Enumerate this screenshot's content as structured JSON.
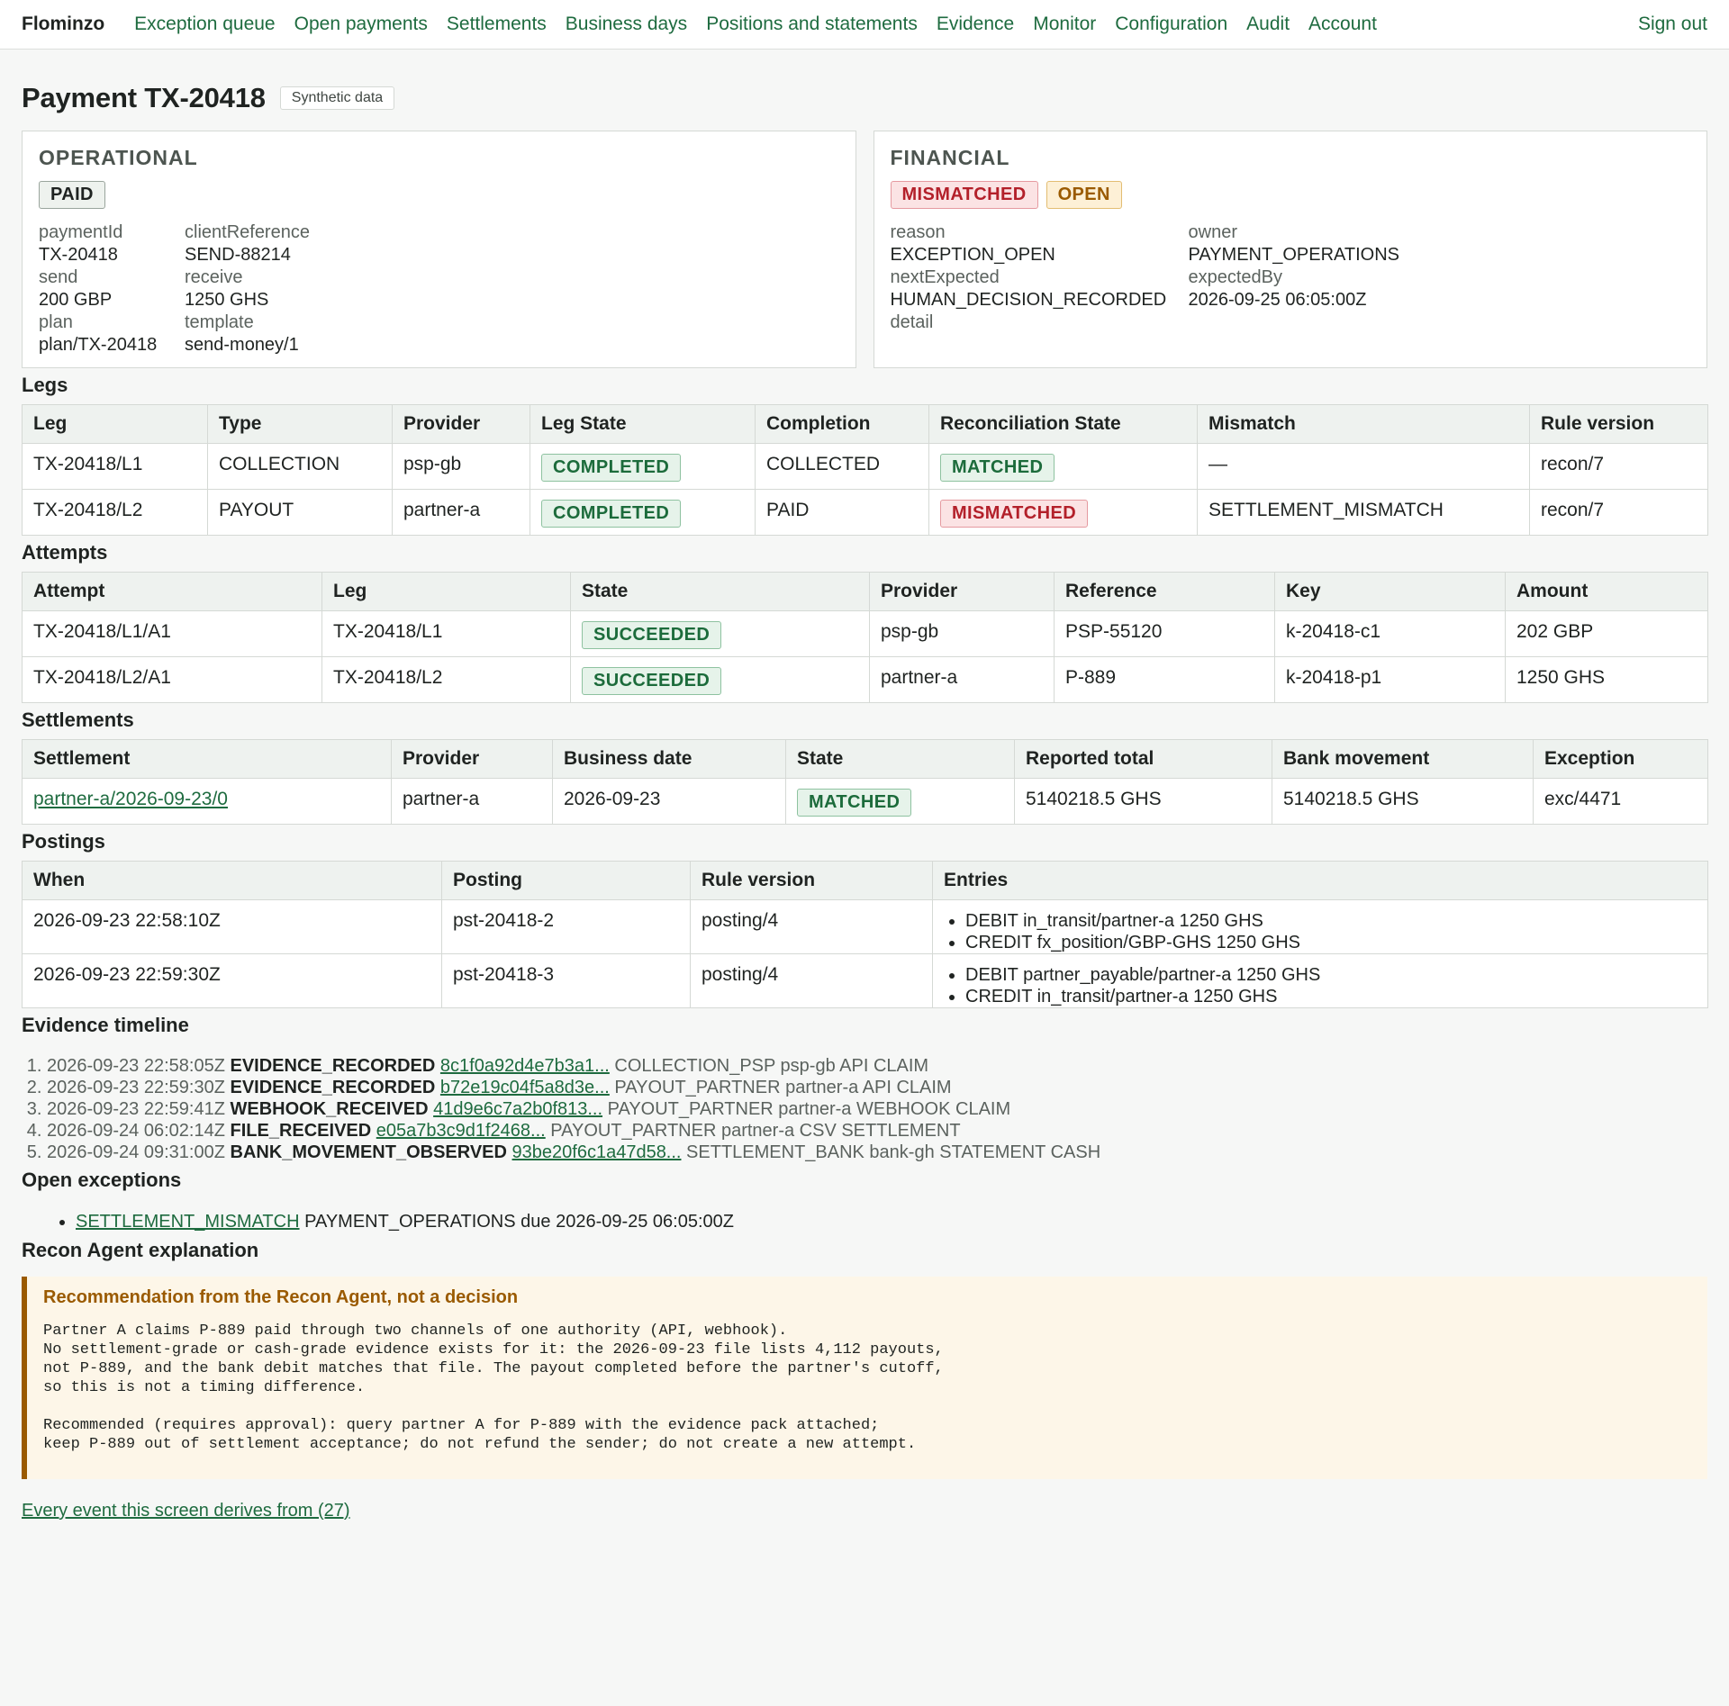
{
  "brand": "Flominzo",
  "nav": [
    "Exception queue",
    "Open payments",
    "Settlements",
    "Business days",
    "Positions and statements",
    "Evidence",
    "Monitor",
    "Configuration",
    "Audit",
    "Account"
  ],
  "sign_out": "Sign out",
  "page": {
    "title": "Payment TX-20418",
    "tag": "Synthetic data"
  },
  "operational": {
    "title": "OPERATIONAL",
    "badge": "PAID",
    "fields": [
      {
        "k": "paymentId",
        "v": "TX-20418"
      },
      {
        "k": "clientReference",
        "v": "SEND-88214"
      },
      {
        "k": "send",
        "v": "200 GBP"
      },
      {
        "k": "receive",
        "v": "1250 GHS"
      },
      {
        "k": "plan",
        "v": "plan/TX-20418"
      },
      {
        "k": "template",
        "v": "send-money/1"
      }
    ]
  },
  "financial": {
    "title": "FINANCIAL",
    "badges": [
      "MISMATCHED",
      "OPEN"
    ],
    "fields": [
      {
        "k": "reason",
        "v": "EXCEPTION_OPEN"
      },
      {
        "k": "owner",
        "v": "PAYMENT_OPERATIONS"
      },
      {
        "k": "nextExpected",
        "v": "HUMAN_DECISION_RECORDED"
      },
      {
        "k": "expectedBy",
        "v": "2026-09-25 06:05:00Z"
      },
      {
        "k": "detail",
        "v": ""
      }
    ]
  },
  "legs": {
    "title": "Legs",
    "columns": [
      "Leg",
      "Type",
      "Provider",
      "Leg State",
      "Completion",
      "Reconciliation State",
      "Mismatch",
      "Rule version"
    ],
    "rows": [
      [
        "TX-20418/L1",
        "COLLECTION",
        "psp-gb",
        "COMPLETED",
        "COLLECTED",
        "MATCHED",
        "—",
        "recon/7"
      ],
      [
        "TX-20418/L2",
        "PAYOUT",
        "partner-a",
        "COMPLETED",
        "PAID",
        "MISMATCHED",
        "SETTLEMENT_MISMATCH",
        "recon/7"
      ]
    ]
  },
  "attempts": {
    "title": "Attempts",
    "columns": [
      "Attempt",
      "Leg",
      "State",
      "Provider",
      "Reference",
      "Key",
      "Amount"
    ],
    "rows": [
      [
        "TX-20418/L1/A1",
        "TX-20418/L1",
        "SUCCEEDED",
        "psp-gb",
        "PSP-55120",
        "k-20418-c1",
        "202 GBP"
      ],
      [
        "TX-20418/L2/A1",
        "TX-20418/L2",
        "SUCCEEDED",
        "partner-a",
        "P-889",
        "k-20418-p1",
        "1250 GHS"
      ]
    ]
  },
  "settlements": {
    "title": "Settlements",
    "columns": [
      "Settlement",
      "Provider",
      "Business date",
      "State",
      "Reported total",
      "Bank movement",
      "Exception"
    ],
    "rows": [
      [
        "partner-a/2026-09-23/0",
        "partner-a",
        "2026-09-23",
        "MATCHED",
        "5140218.5 GHS",
        "5140218.5 GHS",
        "exc/4471"
      ]
    ]
  },
  "postings": {
    "title": "Postings",
    "columns": [
      "When",
      "Posting",
      "Rule version",
      "Entries"
    ],
    "rows": [
      {
        "when": "2026-09-23 22:58:10Z",
        "posting": "pst-20418-2",
        "rule": "posting/4",
        "entries": [
          "DEBIT in_transit/partner-a 1250 GHS",
          "CREDIT fx_position/GBP-GHS 1250 GHS"
        ]
      },
      {
        "when": "2026-09-23 22:59:30Z",
        "posting": "pst-20418-3",
        "rule": "posting/4",
        "entries": [
          "DEBIT partner_payable/partner-a 1250 GHS",
          "CREDIT in_transit/partner-a 1250 GHS"
        ]
      }
    ]
  },
  "timeline": {
    "title": "Evidence timeline",
    "items": [
      {
        "ts": "2026-09-23 22:58:05Z",
        "event": "EVIDENCE_RECORDED",
        "hash": "8c1f0a92d4e7b3a1...",
        "desc": "COLLECTION_PSP psp-gb API CLAIM"
      },
      {
        "ts": "2026-09-23 22:59:30Z",
        "event": "EVIDENCE_RECORDED",
        "hash": "b72e19c04f5a8d3e...",
        "desc": "PAYOUT_PARTNER partner-a API CLAIM"
      },
      {
        "ts": "2026-09-23 22:59:41Z",
        "event": "WEBHOOK_RECEIVED",
        "hash": "41d9e6c7a2b0f813...",
        "desc": "PAYOUT_PARTNER partner-a WEBHOOK CLAIM"
      },
      {
        "ts": "2026-09-24 06:02:14Z",
        "event": "FILE_RECEIVED",
        "hash": "e05a7b3c9d1f2468...",
        "desc": "PAYOUT_PARTNER partner-a CSV SETTLEMENT"
      },
      {
        "ts": "2026-09-24 09:31:00Z",
        "event": "BANK_MOVEMENT_OBSERVED",
        "hash": "93be20f6c1a47d58...",
        "desc": "SETTLEMENT_BANK bank-gh STATEMENT CASH"
      }
    ]
  },
  "exceptions": {
    "title": "Open exceptions",
    "items": [
      {
        "code": "SETTLEMENT_MISMATCH",
        "desc": "PAYMENT_OPERATIONS due 2026-09-25 06:05:00Z"
      }
    ]
  },
  "agent": {
    "title": "Recon Agent explanation",
    "callout_title": "Recommendation from the Recon Agent, not a decision",
    "body": "Partner A claims P-889 paid through two channels of one authority (API, webhook).\nNo settlement-grade or cash-grade evidence exists for it: the 2026-09-23 file lists 4,112 payouts,\nnot P-889, and the bank debit matches that file. The payout completed before the partner's cutoff,\nso this is not a timing difference.\n\nRecommended (requires approval): query partner A for P-889 with the evidence pack attached;\nkeep P-889 out of settlement acceptance; do not refund the sender; do not create a new attempt."
  },
  "footer_link": "Every event this screen derives from (27)"
}
